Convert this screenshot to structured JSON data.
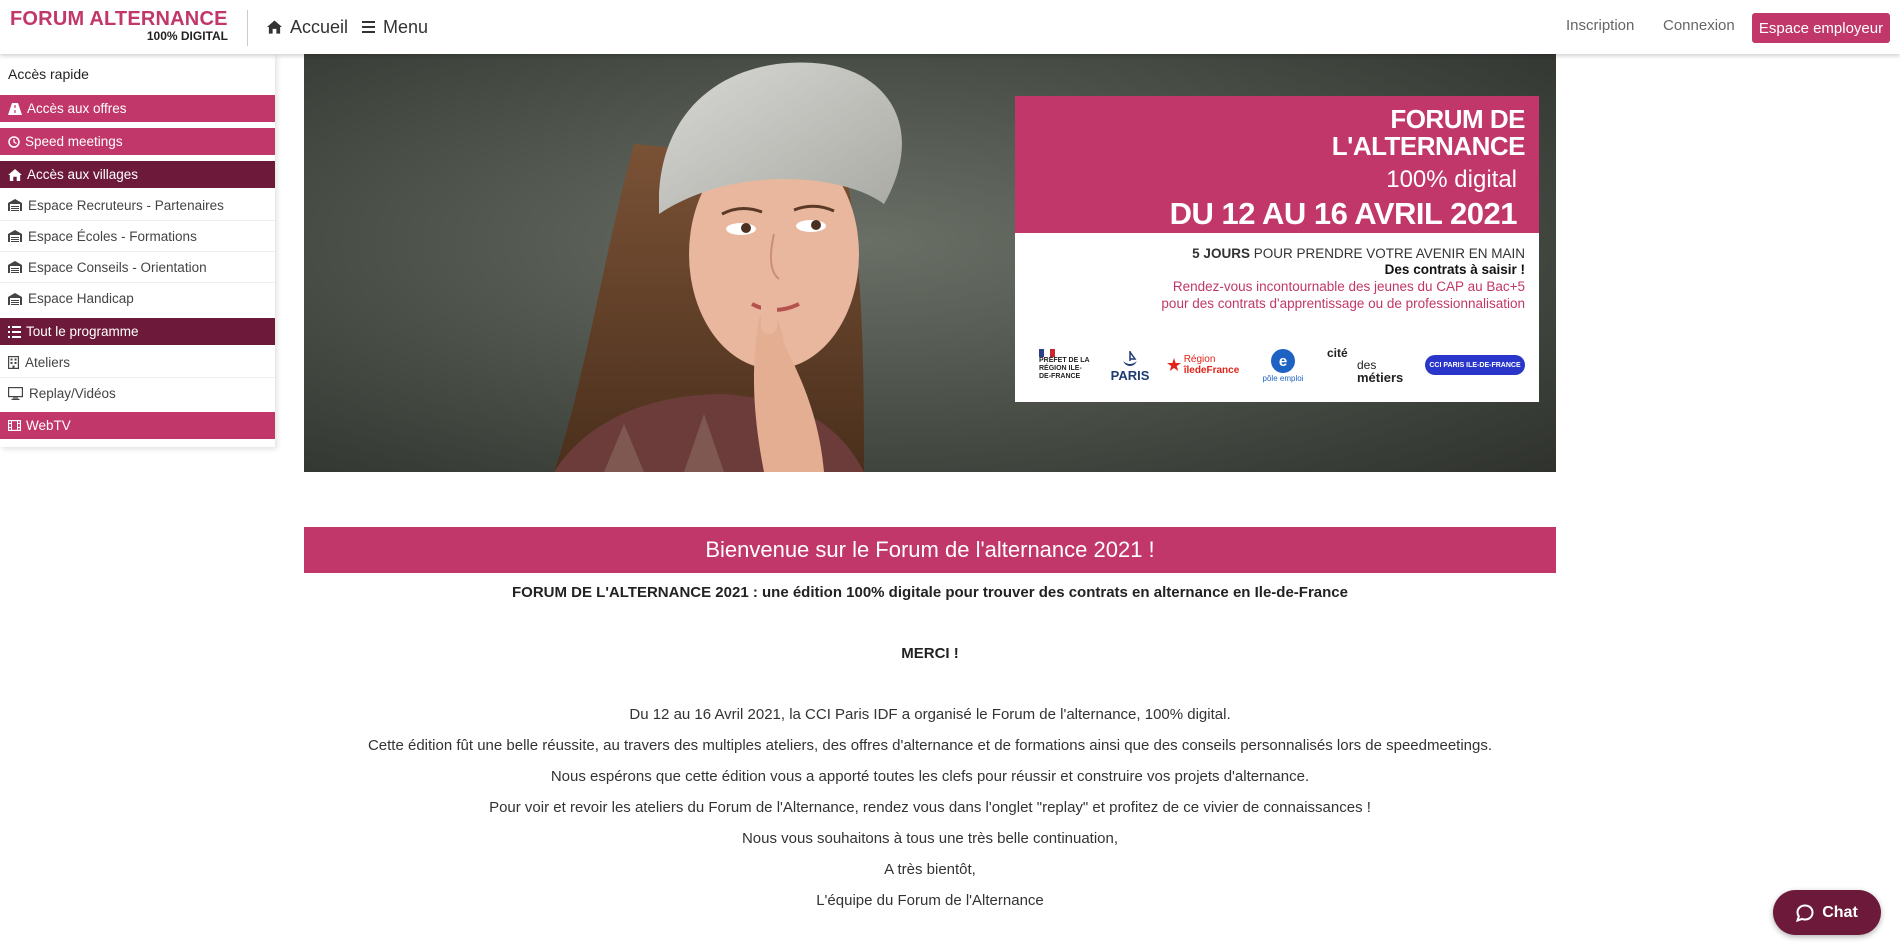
{
  "navbar": {
    "logo_title": "FORUM ALTERNANCE",
    "logo_subtitle": "100% DIGITAL",
    "home_label": "Accueil",
    "menu_label": "Menu",
    "signup_label": "Inscription",
    "login_label": "Connexion",
    "employer_label": "Espace employeur"
  },
  "sidebar": {
    "heading": "Accès rapide",
    "offres": "Accès aux offres",
    "speed": "Speed meetings",
    "villages": "Accès aux villages",
    "village_items": [
      "Espace Recruteurs - Partenaires",
      "Espace Écoles - Formations",
      "Espace Conseils - Orientation",
      "Espace Handicap"
    ],
    "programme": "Tout le programme",
    "programme_items": [
      "Ateliers",
      "Replay/Vidéos"
    ],
    "webtv": "WebTV"
  },
  "hero": {
    "title_line1": "FORUM DE",
    "title_line2": "L'ALTERNANCE",
    "digital": "100% digital",
    "dates": "DU 12 AU 16 AVRIL 2021",
    "line1_bold": "5 JOURS",
    "line1_rest": " POUR PRENDRE VOTRE AVENIR EN MAIN",
    "line2": "Des contrats à saisir !",
    "line3": "Rendez-vous incontournable des jeunes du CAP au Bac+5",
    "line4": "pour des contrats d'apprentissage ou de professionnalisation",
    "partners": {
      "prefet": "PRÉFET DE LA RÉGION ILE-DE-FRANCE",
      "paris": "PARIS",
      "region_a": "Région",
      "region_b": "îledeFrance",
      "pole": "pôle emploi",
      "cite_a": "cité",
      "cite_b": "des",
      "cite_c": "métiers",
      "cci": "CCI PARIS ILE-DE-FRANCE"
    }
  },
  "welcome": {
    "banner": "Bienvenue sur le Forum de l'alternance 2021 !",
    "subtitle": "FORUM DE L'ALTERNANCE 2021 : une édition 100% digitale pour trouver des contrats en alternance en Ile-de-France",
    "merci": "MERCI !",
    "paragraphs": [
      "Du 12 au 16 Avril 2021, la CCI Paris IDF a organisé le Forum de l'alternance, 100% digital.",
      "Cette édition fût une belle réussite, au travers des multiples ateliers, des offres d'alternance et de formations ainsi que des conseils personnalisés lors de speedmeetings.",
      "Nous espérons que cette édition vous a apporté toutes les clefs pour réussir et construire vos projets d'alternance.",
      "Pour voir et revoir les ateliers du Forum de l'Alternance, rendez vous dans l'onglet \"replay\" et profitez de ce vivier de connaissances !",
      "Nous vous souhaitons à tous une très belle continuation,",
      "A très bientôt,",
      "L'équipe du Forum de l'Alternance"
    ]
  },
  "chat": {
    "label": "Chat"
  },
  "colors": {
    "brand": "#c2376a",
    "brand_dark": "#6d1a3a"
  }
}
